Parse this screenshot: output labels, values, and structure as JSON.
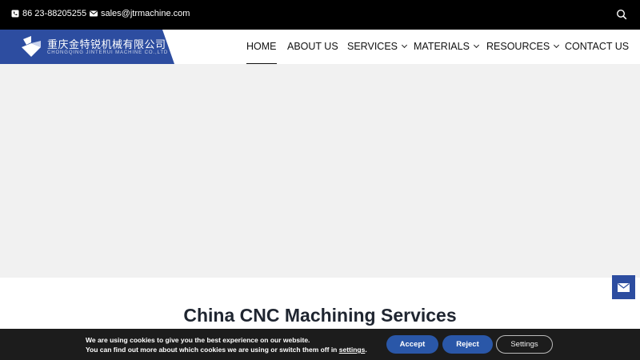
{
  "topbar": {
    "phone": "86 23-88205255",
    "email": "sales@jtrmachine.com",
    "icons": {
      "phone": "phone-icon",
      "email": "envelope-icon",
      "search": "search-icon"
    }
  },
  "logo": {
    "name_cn": "重庆金特锐机械有限公司",
    "name_en": "CHONGQING JINTERUI MACHINE CO.,LTD",
    "color": "#2d4da0"
  },
  "nav": {
    "items": [
      {
        "label": "HOME",
        "active": true,
        "dropdown": false
      },
      {
        "label": "ABOUT US",
        "active": false,
        "dropdown": false
      },
      {
        "label": "SERVICES",
        "active": false,
        "dropdown": true
      },
      {
        "label": "MATERIALS",
        "active": false,
        "dropdown": true
      },
      {
        "label": "RESOURCES",
        "active": false,
        "dropdown": true
      },
      {
        "label": "CONTACT US",
        "active": false,
        "dropdown": false
      }
    ]
  },
  "main": {
    "section_title": "China CNC Machining Services"
  },
  "cookie": {
    "line1": "We are using cookies to give you the best experience on our website.",
    "line2_prefix": "You can find out more about which cookies we are using or switch them off in ",
    "line2_link": "settings",
    "line2_suffix": ".",
    "accept_label": "Accept",
    "reject_label": "Reject",
    "settings_label": "Settings",
    "button_color": "#2a57a8"
  },
  "floating": {
    "mail_icon": "envelope-icon"
  }
}
